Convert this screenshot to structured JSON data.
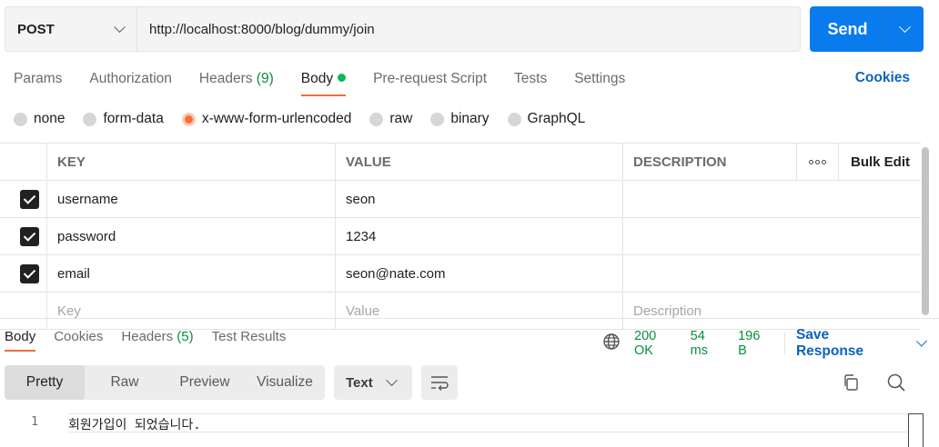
{
  "request": {
    "method": "POST",
    "url": "http://localhost:8000/blog/dummy/join",
    "send_label": "Send"
  },
  "request_tabs": [
    {
      "label": "Params"
    },
    {
      "label": "Authorization"
    },
    {
      "label": "Headers",
      "count": "(9)"
    },
    {
      "label": "Body",
      "active": true,
      "indicator": "green-dot"
    },
    {
      "label": "Pre-request Script"
    },
    {
      "label": "Tests"
    },
    {
      "label": "Settings"
    }
  ],
  "cookies_label": "Cookies",
  "body_types": [
    {
      "label": "none"
    },
    {
      "label": "form-data"
    },
    {
      "label": "x-www-form-urlencoded",
      "selected": true
    },
    {
      "label": "raw"
    },
    {
      "label": "binary"
    },
    {
      "label": "GraphQL"
    }
  ],
  "params_table": {
    "headers": {
      "key": "KEY",
      "value": "VALUE",
      "description": "DESCRIPTION",
      "more": "more-icon",
      "bulk_edit": "Bulk Edit"
    },
    "rows": [
      {
        "checked": true,
        "key": "username",
        "value": "seon",
        "description": ""
      },
      {
        "checked": true,
        "key": "password",
        "value": "1234",
        "description": ""
      },
      {
        "checked": true,
        "key": "email",
        "value": "seon@nate.com",
        "description": ""
      }
    ],
    "placeholders": {
      "key": "Key",
      "value": "Value",
      "description": "Description"
    }
  },
  "response": {
    "tabs": [
      {
        "label": "Body",
        "active": true
      },
      {
        "label": "Cookies"
      },
      {
        "label": "Headers",
        "count": "(5)"
      },
      {
        "label": "Test Results"
      }
    ],
    "status": "200 OK",
    "time": "54 ms",
    "size": "196 B",
    "save_label": "Save Response",
    "view_modes": [
      {
        "label": "Pretty",
        "active": true
      },
      {
        "label": "Raw"
      },
      {
        "label": "Preview"
      },
      {
        "label": "Visualize"
      }
    ],
    "format": "Text",
    "lines": [
      {
        "number": "1",
        "text": "회원가입이 되었습니다."
      }
    ]
  },
  "colors": {
    "accent": "#ff6c37",
    "send_button": "#097bed",
    "link": "#0b63c1",
    "success": "#0a8e3a"
  }
}
